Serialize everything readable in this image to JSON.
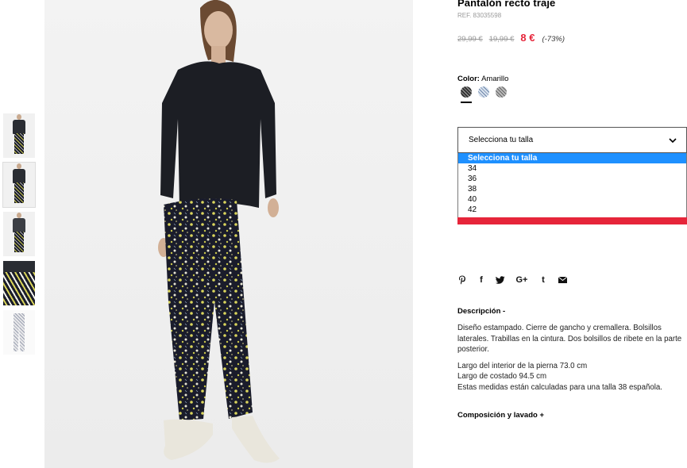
{
  "product": {
    "title": "Pantalón recto traje",
    "ref": "REF. 83035598",
    "price_original": "29,99 €",
    "price_previous": "19,99 €",
    "price_current": "8 €",
    "discount": "(-73%)"
  },
  "color": {
    "label": "Color:",
    "value": "Amarillo",
    "swatches": [
      "pattern-dark",
      "pattern-blue",
      "pattern-grey"
    ]
  },
  "size": {
    "placeholder": "Selecciona tu talla",
    "options": [
      "Selecciona tu talla",
      "34",
      "36",
      "38",
      "40",
      "42"
    ],
    "highlighted": "Selecciona tu talla"
  },
  "share": {
    "icons": [
      "pinterest-icon",
      "facebook-icon",
      "twitter-icon",
      "google-plus-icon",
      "tumblr-icon",
      "mail-icon"
    ],
    "glyphs": {
      "facebook": "f",
      "google": "G+",
      "tumblr": "t"
    }
  },
  "description": {
    "heading": "Descripción -",
    "para1": "Diseño estampado. Cierre de gancho y cremallera. Bolsillos laterales. Trabillas en la cintura. Dos bolsillos de ribete en la parte posterior.",
    "line1": "Largo del interior de la pierna 73.0 cm",
    "line2": "Largo de costado 94.5 cm",
    "line3": "Estas medidas están calculadas para una talla 38 española."
  },
  "composition": {
    "heading": "Composición y lavado +"
  },
  "colors": {
    "accent_red": "#e6253a",
    "highlight_blue": "#1e90ff"
  }
}
